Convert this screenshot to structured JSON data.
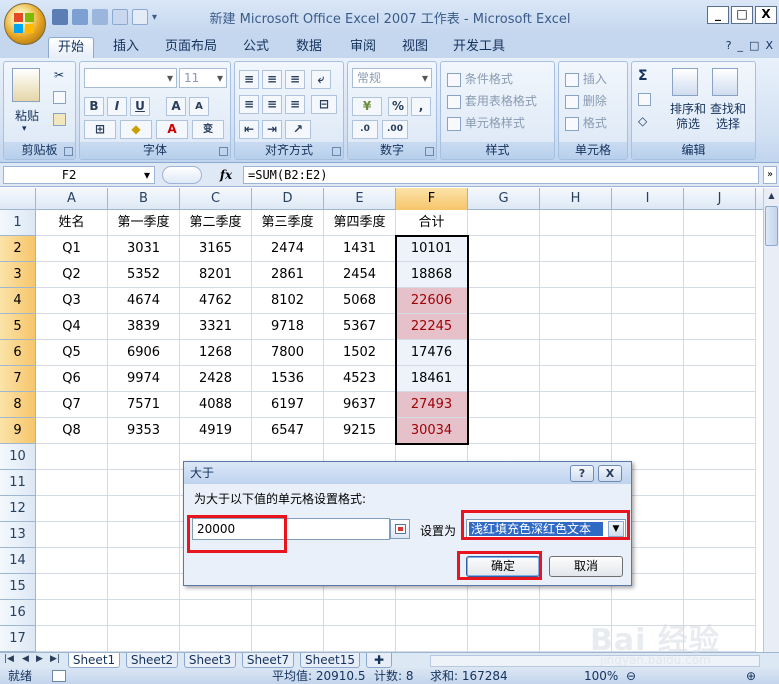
{
  "window": {
    "title": "新建 Microsoft Office Excel 2007 工作表 - Microsoft Excel",
    "controls": [
      "_",
      "□",
      "X"
    ]
  },
  "tabs": [
    "开始",
    "插入",
    "页面布局",
    "公式",
    "数据",
    "审阅",
    "视图",
    "开发工具"
  ],
  "tab_right": [
    "?",
    "_",
    "□",
    "X"
  ],
  "ribbon": {
    "clipboard": {
      "label": "剪贴板",
      "paste": "粘贴"
    },
    "font": {
      "label": "字体",
      "font_size": "11"
    },
    "alignment": {
      "label": "对齐方式"
    },
    "number": {
      "label": "数字",
      "format": "常规"
    },
    "styles": {
      "label": "样式",
      "items": [
        "条件格式",
        "套用表格格式",
        "单元格样式"
      ]
    },
    "cells": {
      "label": "单元格",
      "items": [
        "插入",
        "删除",
        "格式"
      ]
    },
    "editing": {
      "label": "编辑",
      "sort": "排序和筛选",
      "find": "查找和选择"
    }
  },
  "formula_bar": {
    "name_box": "F2",
    "fx": "fx",
    "formula": "=SUM(B2:E2)"
  },
  "sheet": {
    "columns": [
      "A",
      "B",
      "C",
      "D",
      "E",
      "F",
      "G",
      "H",
      "I",
      "J"
    ],
    "rows": [
      "1",
      "2",
      "3",
      "4",
      "5",
      "6",
      "7",
      "8",
      "9",
      "10",
      "11",
      "12",
      "13",
      "14",
      "15",
      "16",
      "17"
    ],
    "header": [
      "姓名",
      "第一季度",
      "第二季度",
      "第三季度",
      "第四季度",
      "合计"
    ],
    "data": [
      [
        "Q1",
        "3031",
        "3165",
        "2474",
        "1431",
        "10101"
      ],
      [
        "Q2",
        "5352",
        "8201",
        "2861",
        "2454",
        "18868"
      ],
      [
        "Q3",
        "4674",
        "4762",
        "8102",
        "5068",
        "22606"
      ],
      [
        "Q4",
        "3839",
        "3321",
        "9718",
        "5367",
        "22245"
      ],
      [
        "Q5",
        "6906",
        "1268",
        "7800",
        "1502",
        "17476"
      ],
      [
        "Q6",
        "9974",
        "2428",
        "1536",
        "4523",
        "18461"
      ],
      [
        "Q7",
        "7571",
        "4088",
        "6197",
        "9637",
        "27493"
      ],
      [
        "Q8",
        "9353",
        "4919",
        "6547",
        "9215",
        "30034"
      ]
    ],
    "highlight_color": "#9c0006",
    "highlight_fill": "#ffc7ce"
  },
  "sheet_tabs": [
    "Sheet1",
    "Sheet2",
    "Sheet3",
    "Sheet7",
    "Sheet15"
  ],
  "status": {
    "ready": "就绪",
    "average": "平均值: 20910.5",
    "count": "计数: 8",
    "sum": "求和: 167284",
    "zoom": "100%"
  },
  "dialog": {
    "title": "大于",
    "help": "?",
    "close": "X",
    "prompt": "为大于以下值的单元格设置格式:",
    "value": "20000",
    "set_label": "设置为",
    "selected_option": "浅红填充色深红色文本",
    "ok": "确定",
    "cancel": "取消"
  },
  "watermark": {
    "brand": "Bai 经验",
    "url": "jingyan.baidu.com"
  }
}
